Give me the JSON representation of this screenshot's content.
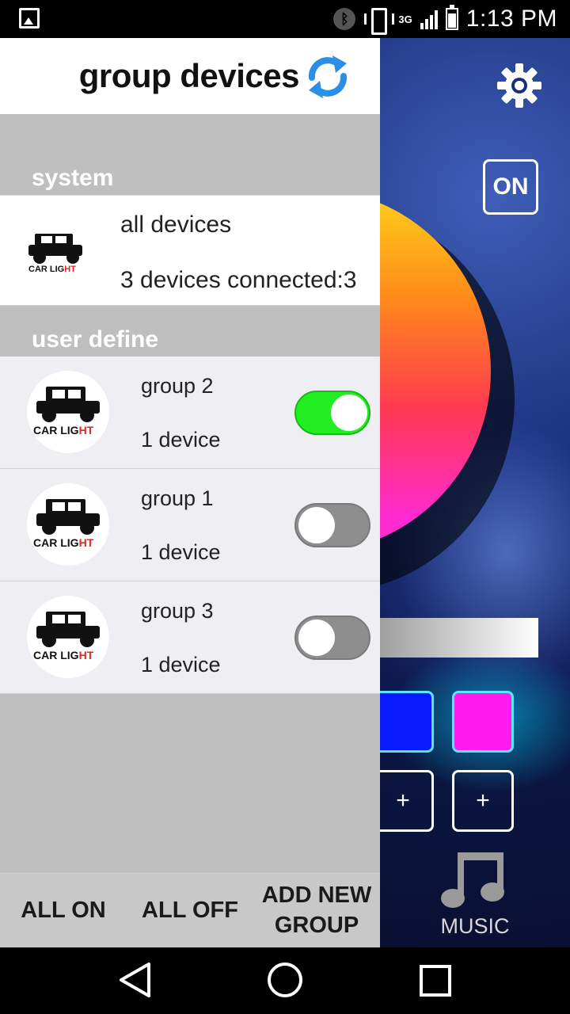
{
  "status_bar": {
    "time": "1:13 PM",
    "network": "3G",
    "icons": [
      "gallery-icon",
      "bluetooth-icon",
      "vibrate-icon",
      "signal-icon",
      "battery-icon"
    ]
  },
  "background_app": {
    "power_label": "ON",
    "plus_label": "+",
    "music_label": "MUSIC",
    "swatches": [
      "#0a1aff",
      "#ff1af0"
    ]
  },
  "drawer": {
    "title": "group devices",
    "sections": {
      "system_label": "system",
      "user_label": "user define"
    },
    "all_devices": {
      "name": "all devices",
      "status": "3 devices connected:3",
      "logo_text_black": "CAR LIG",
      "logo_text_red": "HT"
    },
    "groups": [
      {
        "name": "group 2",
        "devices": "1 device",
        "enabled": true
      },
      {
        "name": "group 1",
        "devices": "1 device",
        "enabled": false
      },
      {
        "name": "group 3",
        "devices": "1 device",
        "enabled": false
      }
    ],
    "footer": {
      "all_on": "ALL ON",
      "all_off": "ALL OFF",
      "add_new_line1": "ADD NEW",
      "add_new_line2": "GROUP"
    }
  },
  "colors": {
    "toggle_on": "#22ee22",
    "toggle_off": "#8e8e8e",
    "refresh_blue": "#2b8fe8",
    "logo_red": "#e52222"
  }
}
